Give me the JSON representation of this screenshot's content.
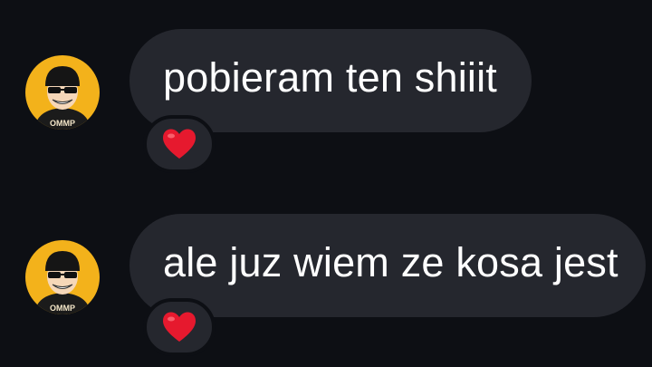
{
  "thread": {
    "messages": [
      {
        "text": "pobieram ten shiiit",
        "reaction": "heart-emoji",
        "avatar_badge": "OMMP"
      },
      {
        "text": "ale juz wiem ze kosa jest",
        "reaction": "heart-emoji",
        "avatar_badge": "OMMP"
      }
    ]
  },
  "colors": {
    "background": "#0d0f14",
    "bubble": "#25272e",
    "text": "#ffffff",
    "heart": "#e6192e",
    "avatar_bg": "#f3b21b"
  }
}
